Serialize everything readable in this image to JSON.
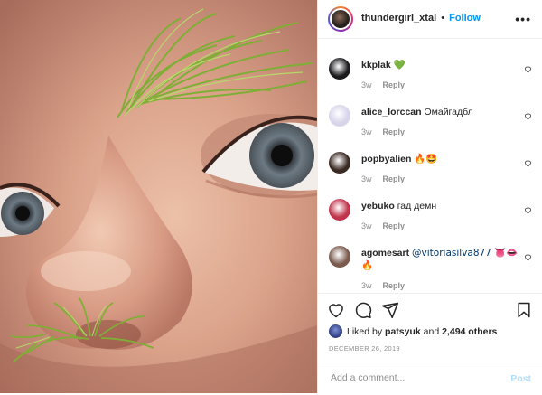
{
  "header": {
    "username": "thundergirl_xtal",
    "separator": "•",
    "follow_label": "Follow",
    "more_label": "•••"
  },
  "comments": [
    {
      "username": "kkplak",
      "text": "💚",
      "time": "3w",
      "reply_label": "Reply",
      "avatar_color": "#1b1b1f"
    },
    {
      "username": "alice_lorccan",
      "text": "Омайгадбл",
      "time": "3w",
      "reply_label": "Reply",
      "avatar_color": "#d8d4ea"
    },
    {
      "username": "popbyalien",
      "text": "🔥🤩",
      "time": "3w",
      "reply_label": "Reply",
      "avatar_color": "#3a2a24"
    },
    {
      "username": "yebuko",
      "text": "гад демн",
      "time": "3w",
      "reply_label": "Reply",
      "avatar_color": "#c0334a"
    },
    {
      "username": "agomesart",
      "text": "@vitoriasilva877 👅👄🔥",
      "time": "3w",
      "reply_label": "Reply",
      "avatar_color": "#7a5b4e"
    }
  ],
  "likes": {
    "prefix": "Liked by",
    "user": "patsyuk",
    "conjunction": "and",
    "count": "2,494 others"
  },
  "date": "DECEMBER 26, 2019",
  "add_comment": {
    "placeholder": "Add a comment...",
    "post_label": "Post"
  },
  "colors": {
    "accent_blue": "#0095f6",
    "post_disabled": "#b2dffc",
    "secondary_text": "#8e8e8e",
    "emoji_green_heart": "#2ecc40"
  },
  "icons": {
    "like": "heart-icon",
    "comment": "comment-icon",
    "share": "paper-plane-icon",
    "save": "bookmark-icon",
    "more": "more-options-icon"
  }
}
